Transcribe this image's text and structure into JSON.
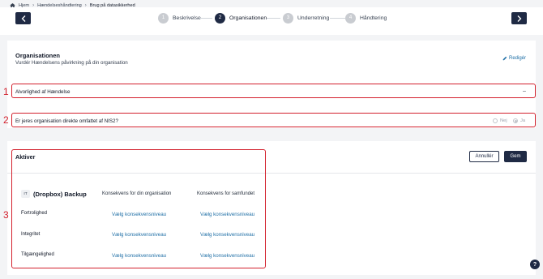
{
  "breadcrumb": {
    "home": "Hjem",
    "parent": "Hændelseshåndtering",
    "current": "Brug på datasikkerhed"
  },
  "stepper": {
    "steps": [
      {
        "num": "1",
        "label": "Beskrivelse"
      },
      {
        "num": "2",
        "label": "Organisationen"
      },
      {
        "num": "3",
        "label": "Underretning"
      },
      {
        "num": "4",
        "label": "Håndtering"
      }
    ],
    "active_step": 2
  },
  "org": {
    "title": "Organisationen",
    "subtitle": "Vurdér Hændelsens påvirkning på din organisation",
    "edit": "Redigér"
  },
  "severity": {
    "label": "Alvorlighed af Hændelse",
    "toggle": "–"
  },
  "nis": {
    "question": "Er jeres organisation direkte omfattet af NIS2?",
    "option_no": "Nej",
    "option_yes": "Ja",
    "selected": "Ja"
  },
  "assets": {
    "title": "Aktiver",
    "cancel": "Annullér",
    "save": "Gem",
    "badge": "IT",
    "asset_name": "(Dropbox) Backup",
    "col_org": "Konsekvens for din organisation",
    "col_society": "Konsekvens for samfundet",
    "rows": [
      {
        "label": "Fortrolighed",
        "org_link": "Vælg konsekvensniveau",
        "society_link": "Vælg konsekvensniveau"
      },
      {
        "label": "Integritet",
        "org_link": "Vælg konsekvensniveau",
        "society_link": "Vælg konsekvensniveau"
      },
      {
        "label": "Tilgængelighed",
        "org_link": "Vælg konsekvensniveau",
        "society_link": "Vælg konsekvensniveau"
      }
    ]
  },
  "markers": [
    "1",
    "2",
    "3"
  ],
  "help": "?",
  "colors": {
    "primary": "#1f2a44",
    "link": "#1f6fa6",
    "highlight": "#d3212d"
  }
}
